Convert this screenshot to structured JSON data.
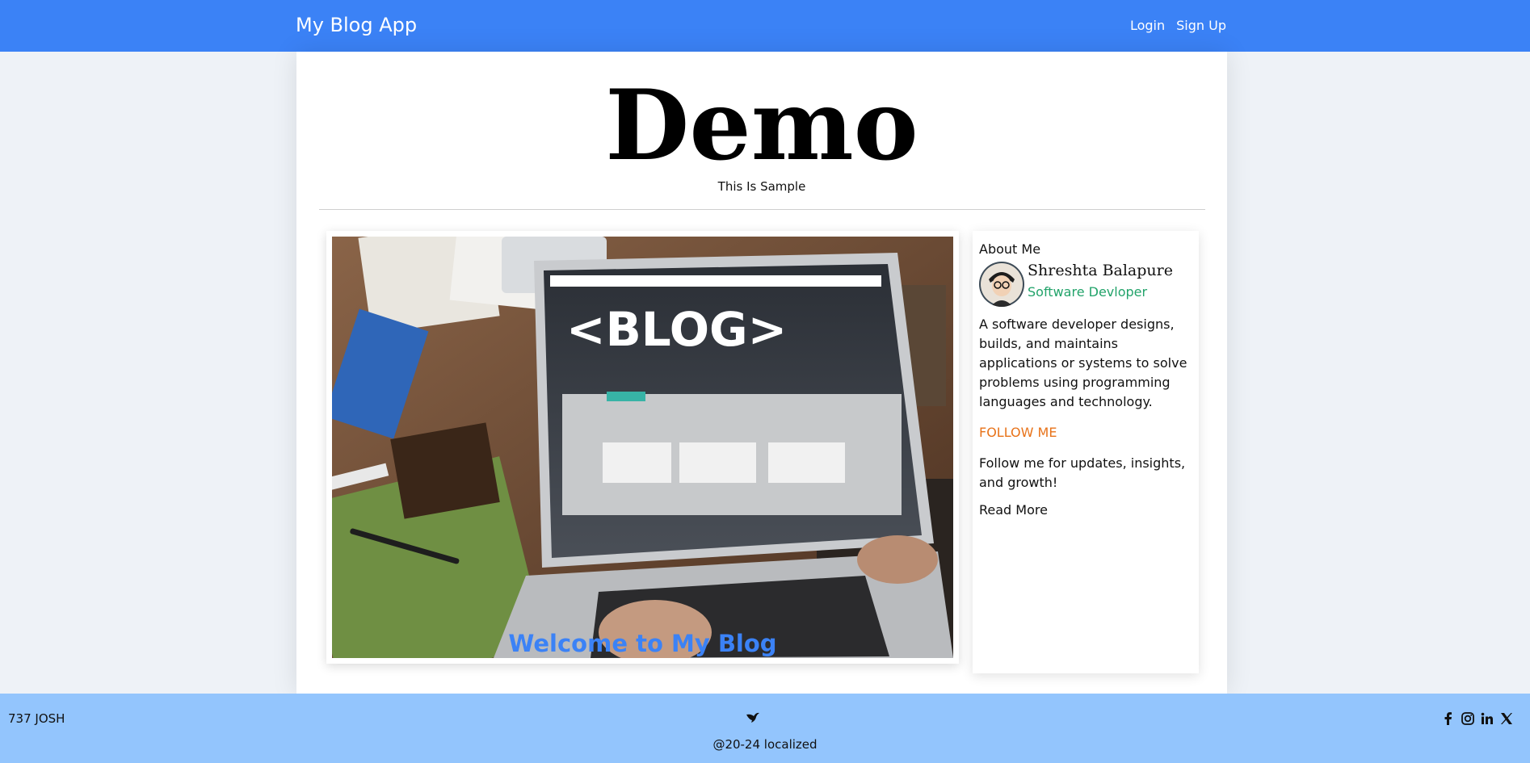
{
  "navbar": {
    "brand": "My Blog App",
    "links": [
      {
        "label": "Login"
      },
      {
        "label": "Sign Up"
      }
    ]
  },
  "hero": {
    "title": "Demo",
    "subtitle": "This Is Sample"
  },
  "featured": {
    "caption": "Welcome to My Blog",
    "image_text": "<BLOG>"
  },
  "sidebar": {
    "heading": "About Me",
    "author_name": "Shreshta Balapure",
    "author_role": "Software Devloper",
    "bio": "A software developer designs, builds, and maintains applications or systems to solve problems using programming languages and technology.",
    "follow_heading": "FOLLOW ME",
    "follow_text": "Follow me for updates, insights, and growth!",
    "read_more": "Read More"
  },
  "footer": {
    "left_text": "737 JOSH",
    "copyright": "@20-24 localized",
    "social": [
      "facebook-icon",
      "instagram-icon",
      "linkedin-icon",
      "x-icon"
    ]
  },
  "colors": {
    "primary": "#3b82f6",
    "footer_bg": "#93c5fd",
    "role_green": "#22a36a",
    "follow_orange": "#e8731a"
  }
}
